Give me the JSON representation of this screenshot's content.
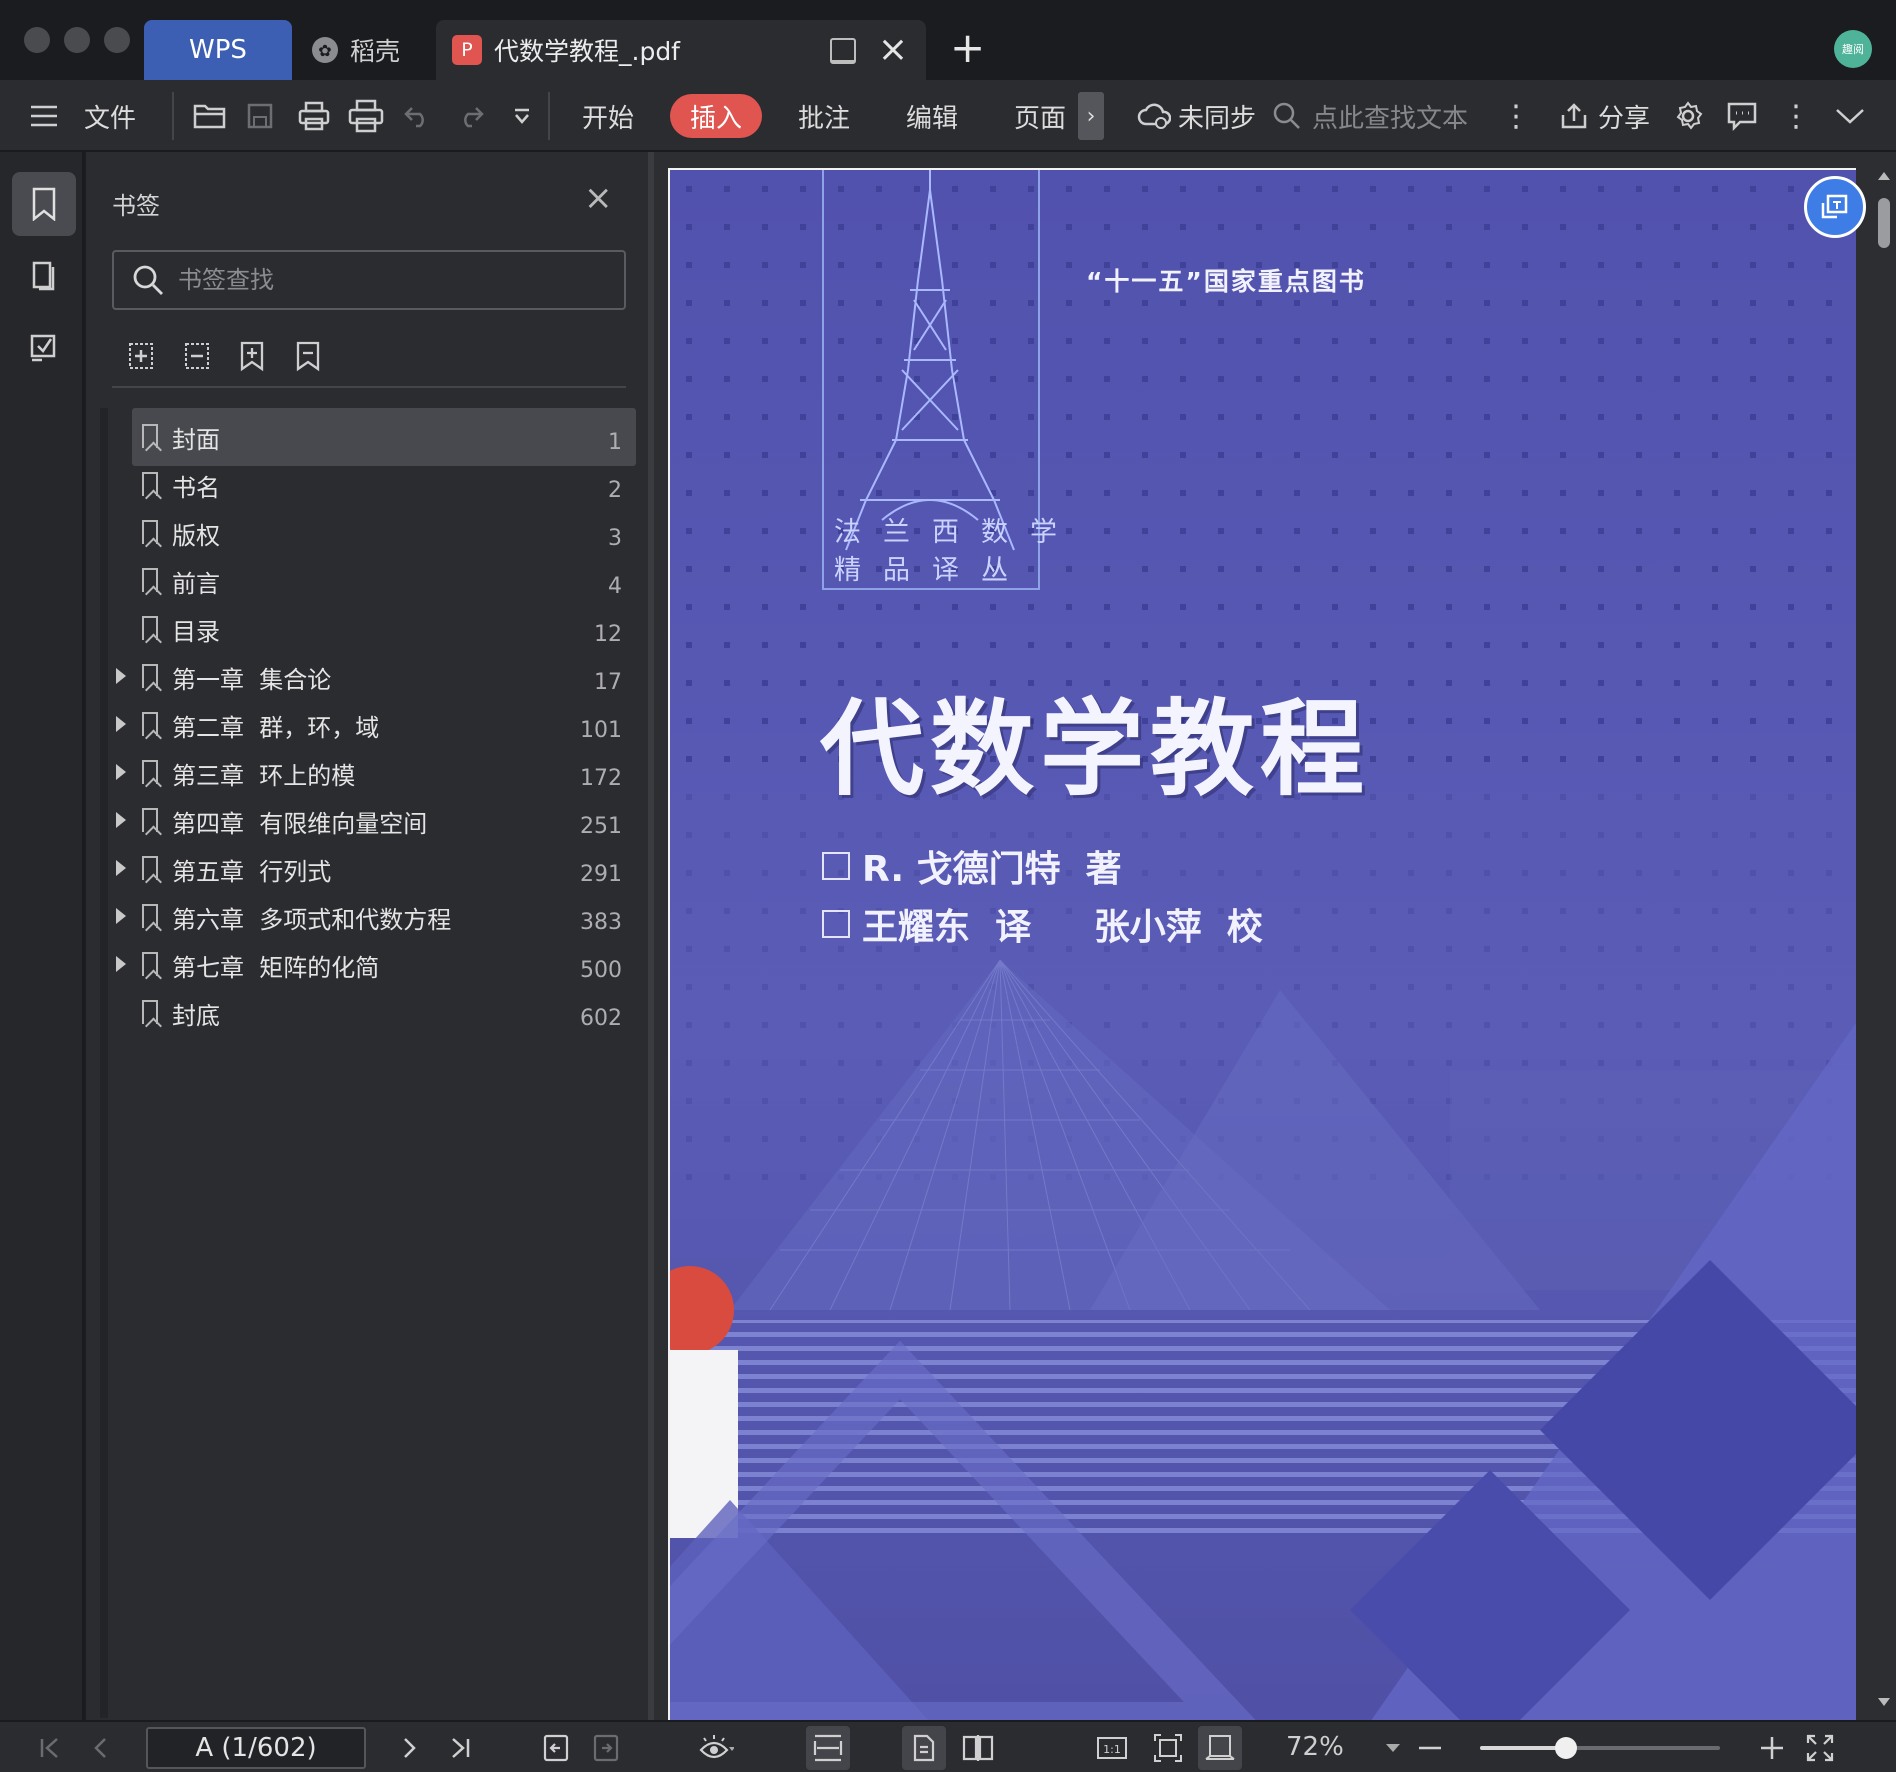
{
  "titlebar": {
    "tabs": [
      {
        "label": "WPS"
      },
      {
        "label": "稻壳"
      },
      {
        "label": "代数学教程_.pdf"
      }
    ],
    "avatar_text": "趣阅"
  },
  "toolbar": {
    "file_label": "文件",
    "menus": [
      "开始",
      "插入",
      "批注",
      "编辑",
      "页面"
    ],
    "active_menu": "插入",
    "sync_label": "未同步",
    "search_placeholder": "点此查找文本",
    "share_label": "分享"
  },
  "bookmarks": {
    "title": "书签",
    "search_placeholder": "书签查找",
    "items": [
      {
        "label": "封面",
        "page": "1",
        "expandable": false,
        "selected": true
      },
      {
        "label": "书名",
        "page": "2",
        "expandable": false,
        "selected": false
      },
      {
        "label": "版权",
        "page": "3",
        "expandable": false,
        "selected": false
      },
      {
        "label": "前言",
        "page": "4",
        "expandable": false,
        "selected": false
      },
      {
        "label": "目录",
        "page": "12",
        "expandable": false,
        "selected": false
      },
      {
        "label": "第一章  集合论",
        "page": "17",
        "expandable": true,
        "selected": false
      },
      {
        "label": "第二章  群，环，域",
        "page": "101",
        "expandable": true,
        "selected": false
      },
      {
        "label": "第三章  环上的模",
        "page": "172",
        "expandable": true,
        "selected": false
      },
      {
        "label": "第四章  有限维向量空间",
        "page": "251",
        "expandable": true,
        "selected": false
      },
      {
        "label": "第五章  行列式",
        "page": "291",
        "expandable": true,
        "selected": false
      },
      {
        "label": "第六章  多项式和代数方程",
        "page": "383",
        "expandable": true,
        "selected": false
      },
      {
        "label": "第七章  矩阵的化简",
        "page": "500",
        "expandable": true,
        "selected": false
      },
      {
        "label": "封底",
        "page": "602",
        "expandable": false,
        "selected": false
      }
    ]
  },
  "document": {
    "series_line1": "法兰西数学",
    "series_line2": "精品译丛",
    "publication_note": "“十一五”国家重点图书",
    "title": "代数学教程",
    "credit_line1": "R. 戈德门特  著",
    "credit_line2": "王耀东  译     张小萍  校"
  },
  "statusbar": {
    "page_field": "A (1/602)",
    "zoom_label": "72%",
    "zoom_fraction": 0.36
  },
  "colors": {
    "accent_insert": "#e0554f",
    "wps_tab": "#3d5fb3",
    "cover_blue": "#5758b0"
  }
}
